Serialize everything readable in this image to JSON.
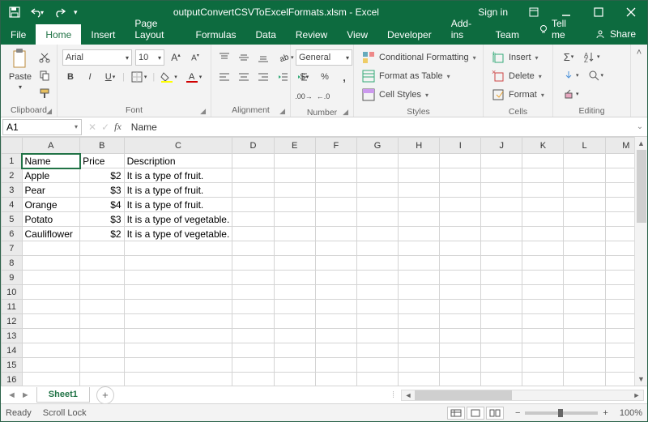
{
  "titlebar": {
    "title": "outputConvertCSVToExcelFormats.xlsm - Excel",
    "signin": "Sign in"
  },
  "tabs": {
    "file": "File",
    "home": "Home",
    "insert": "Insert",
    "pagelayout": "Page Layout",
    "formulas": "Formulas",
    "data": "Data",
    "review": "Review",
    "view": "View",
    "developer": "Developer",
    "addins": "Add-ins",
    "team": "Team",
    "tellme": "Tell me",
    "share": "Share"
  },
  "ribbon": {
    "clipboard": {
      "label": "Clipboard",
      "paste": "Paste"
    },
    "font": {
      "label": "Font",
      "family": "Arial",
      "size": "10",
      "B": "B",
      "I": "I",
      "U": "U"
    },
    "alignment": {
      "label": "Alignment"
    },
    "number": {
      "label": "Number",
      "format": "General"
    },
    "styles": {
      "label": "Styles",
      "cond": "Conditional Formatting",
      "table": "Format as Table",
      "cell": "Cell Styles"
    },
    "cells": {
      "label": "Cells",
      "insert": "Insert",
      "delete": "Delete",
      "format": "Format"
    },
    "editing": {
      "label": "Editing"
    }
  },
  "formula_bar": {
    "namebox": "A1",
    "value": "Name"
  },
  "columns": [
    "A",
    "B",
    "C",
    "D",
    "E",
    "F",
    "G",
    "H",
    "I",
    "J",
    "K",
    "L",
    "M"
  ],
  "rows_visible": 17,
  "active_cell": {
    "row": 1,
    "col": 0
  },
  "sheet_data": {
    "headers": {
      "A": "Name",
      "B": "Price",
      "C": "Description"
    },
    "rows": [
      {
        "A": "Apple",
        "B": "$2",
        "C": "It is a type of fruit."
      },
      {
        "A": "Pear",
        "B": "$3",
        "C": "It is a type of fruit."
      },
      {
        "A": "Orange",
        "B": "$4",
        "C": "It is a type of fruit."
      },
      {
        "A": "Potato",
        "B": "$3",
        "C": "It is a type of vegetable."
      },
      {
        "A": "Cauliflower",
        "B": "$2",
        "C": "It is a type of vegetable."
      }
    ]
  },
  "sheet_tabs": {
    "active": "Sheet1"
  },
  "statusbar": {
    "ready": "Ready",
    "scrolllock": "Scroll Lock",
    "zoom": "100%"
  }
}
